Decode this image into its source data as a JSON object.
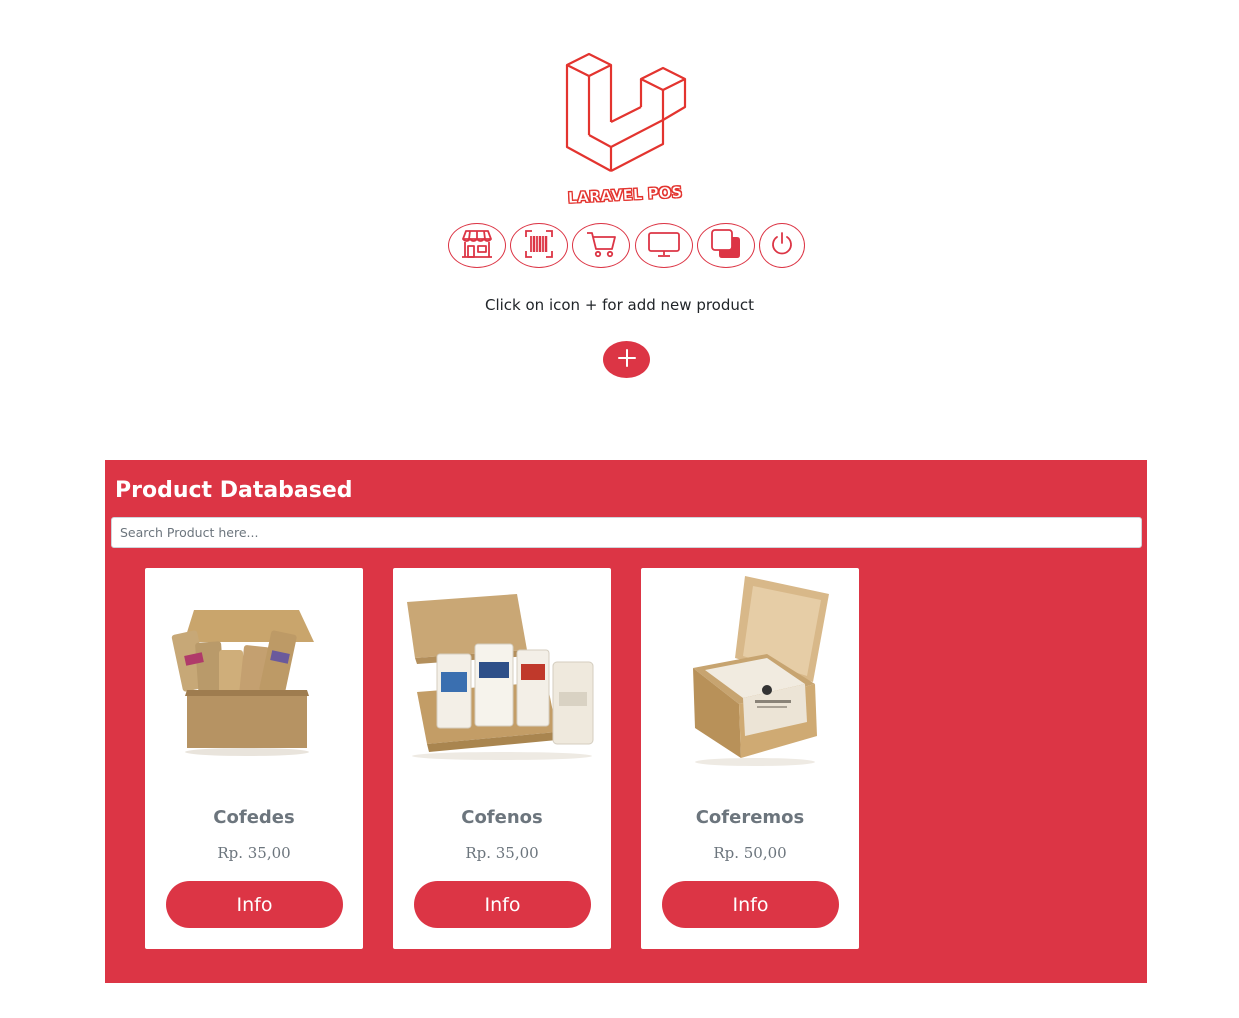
{
  "brand": {
    "name": "LARAVEL POS",
    "accent": "#e3342f"
  },
  "nav": [
    {
      "icon": "store-icon"
    },
    {
      "icon": "barcode-icon"
    },
    {
      "icon": "cart-icon"
    },
    {
      "icon": "monitor-icon"
    },
    {
      "icon": "copy-icon"
    },
    {
      "icon": "power-icon"
    }
  ],
  "hint": "Click on icon + for add new product",
  "add_button": {
    "icon": "plus-icon",
    "color": "#dc3545"
  },
  "panel": {
    "title": "Product Databased",
    "search_placeholder": "Search Product here...",
    "color": "#dc3545"
  },
  "products": [
    {
      "name": "Cofedes",
      "price": "Rp. 35,00",
      "button": "Info",
      "image": "coffee-gift-box-image"
    },
    {
      "name": "Cofenos",
      "price": "Rp. 35,00",
      "button": "Info",
      "image": "coffee-sampler-box-image"
    },
    {
      "name": "Coferemos",
      "price": "Rp. 50,00",
      "button": "Info",
      "image": "coffee-kraft-box-image"
    }
  ]
}
